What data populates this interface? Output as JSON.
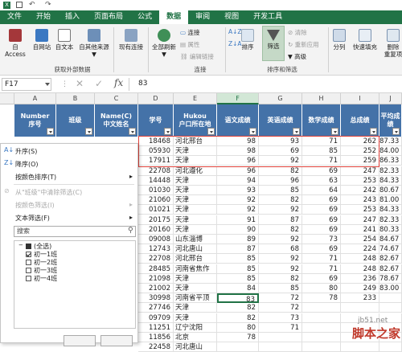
{
  "tabs": [
    "文件",
    "开始",
    "插入",
    "页面布局",
    "公式",
    "数据",
    "审阅",
    "视图",
    "开发工具"
  ],
  "ribbon": {
    "access": "自 Access",
    "web": "自网站",
    "text": "自文本",
    "other_l1": "自其他来源",
    "other_l2": "▼",
    "existing": "现有连接",
    "refresh_l1": "全部刷新",
    "refresh_l2": "▼",
    "connections": "连接",
    "properties": "属性",
    "edit_links": "编辑链接",
    "sort": "排序",
    "filter": "筛选",
    "clear": "清除",
    "reapply": "重新应用",
    "advanced": "高级",
    "split": "分列",
    "flash_fill": "快速填充",
    "remove_dup_l1": "删除",
    "remove_dup_l2": "重复项",
    "group_ext": "获取外部数据",
    "group_conn": "连接",
    "group_sort": "排序和筛选"
  },
  "formula_bar": {
    "name_box": "F17",
    "value": "83"
  },
  "columns": [
    "A",
    "B",
    "C",
    "D",
    "E",
    "F",
    "G",
    "H",
    "I",
    "J"
  ],
  "headers": [
    "Number\n序号",
    "班级",
    "Name(C)\n中文姓名",
    "学号",
    "Hukou\n户口所在地",
    "语文成绩",
    "英语成绩",
    "数学成绩",
    "总成绩",
    "平均成绩"
  ],
  "rows": [
    [
      "18468",
      "河北邢台",
      "98",
      "93",
      "71",
      "262",
      "87.33"
    ],
    [
      "05930",
      "天津",
      "98",
      "69",
      "85",
      "252",
      "84.00"
    ],
    [
      "17911",
      "天津",
      "96",
      "92",
      "71",
      "259",
      "86.33"
    ],
    [
      "22708",
      "河北遵化",
      "96",
      "82",
      "69",
      "247",
      "82.33"
    ],
    [
      "14448",
      "天津",
      "94",
      "96",
      "63",
      "253",
      "84.33"
    ],
    [
      "01030",
      "天津",
      "93",
      "85",
      "64",
      "242",
      "80.67"
    ],
    [
      "21060",
      "天津",
      "92",
      "82",
      "69",
      "243",
      "81.00"
    ],
    [
      "01021",
      "天津",
      "92",
      "92",
      "69",
      "253",
      "84.33"
    ],
    [
      "20175",
      "天津",
      "91",
      "87",
      "69",
      "247",
      "82.33"
    ],
    [
      "20160",
      "天津",
      "90",
      "82",
      "69",
      "241",
      "80.33"
    ],
    [
      "09008",
      "山东淄博",
      "89",
      "92",
      "73",
      "254",
      "84.67"
    ],
    [
      "12743",
      "河北唐山",
      "87",
      "68",
      "69",
      "224",
      "74.67"
    ],
    [
      "22708",
      "河北邢台",
      "85",
      "92",
      "71",
      "248",
      "82.67"
    ],
    [
      "28485",
      "河南省焦作",
      "85",
      "92",
      "71",
      "248",
      "82.67"
    ],
    [
      "21098",
      "天津",
      "85",
      "82",
      "69",
      "236",
      "78.67"
    ],
    [
      "21002",
      "天津",
      "84",
      "85",
      "80",
      "249",
      "83.00"
    ],
    [
      "30998",
      "河南省平顶",
      "83",
      "72",
      "78",
      "233",
      ""
    ],
    [
      "27746",
      "天津",
      "82",
      "72",
      "",
      "",
      " "
    ],
    [
      "09709",
      "天津",
      "82",
      "73",
      "",
      "",
      ""
    ],
    [
      "11251",
      "辽宁沈阳",
      "80",
      "71",
      "",
      "",
      ""
    ],
    [
      "11856",
      "北京",
      "78",
      "",
      "",
      "",
      ""
    ],
    [
      "22458",
      "河北唐山",
      "",
      "",
      "",
      "",
      ""
    ]
  ],
  "filter_menu": {
    "asc": "升序(S)",
    "desc": "降序(O)",
    "by_color": "按颜色排序(T)",
    "clear": "从\"班级\"中清除筛选(C)",
    "filter_color": "按颜色筛选(I)",
    "text_filter": "文本筛选(F)",
    "search_placeholder": "搜索",
    "items": [
      {
        "label": "(全选)",
        "checked": "partial"
      },
      {
        "label": "初一1班",
        "checked": true
      },
      {
        "label": "初一2班",
        "checked": false
      },
      {
        "label": "初一3班",
        "checked": false
      },
      {
        "label": "初一4班",
        "checked": false
      }
    ]
  },
  "watermark": {
    "l1": "jb51.net",
    "l2": "脚本之家"
  },
  "colors": {
    "excel_green": "#217346",
    "header_blue": "#4472a8",
    "highlight_red": "#e0413a",
    "watermark": "#c0392b"
  }
}
